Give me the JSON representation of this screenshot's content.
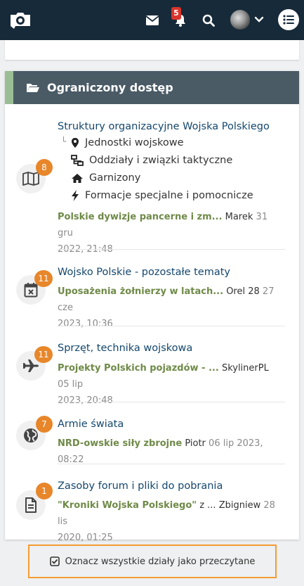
{
  "header": {
    "notification_count": "5"
  },
  "category": {
    "title": "Ograniczony dostęp",
    "forums": [
      {
        "title": "Struktury organizacyjne Wojska Polskiego",
        "count": "8",
        "icon": "map-icon",
        "subforums": [
          {
            "label": "Jednostki wojskowe",
            "icon": "map-marker-icon"
          },
          {
            "label": "Oddziały i związki taktyczne",
            "icon": "sitemap-icon"
          },
          {
            "label": "Garnizony",
            "icon": "home-icon"
          },
          {
            "label": "Formacje specjalne i pomocnicze",
            "icon": "bolt-icon"
          }
        ],
        "last_topic": "Polskie dywizje pancerne i zm...",
        "last_user": "Marek",
        "last_date_a": "31 gru",
        "last_date_b": "2022, 21:48"
      },
      {
        "title": "Wojsko Polskie - pozostałe tematy",
        "count": "11",
        "icon": "calendar-x-icon",
        "last_topic": "Uposażenia żołnierzy w latach...",
        "last_user": "Orel 28",
        "last_date_a": "27 cze",
        "last_date_b": "2023, 10:36"
      },
      {
        "title": "Sprzęt, technika wojskowa",
        "count": "11",
        "icon": "plane-icon",
        "last_topic": "Projekty Polskich pojazdów - ...",
        "last_user": "SkylinerPL",
        "last_date_a": "05 lip",
        "last_date_b": "2023, 20:48"
      },
      {
        "title": "Armie świata",
        "count": "7",
        "icon": "globe-icon",
        "last_topic": "NRD-owskie siły zbrojne",
        "last_user": "Piotr",
        "last_date_a": "06 lip 2023, 08:22"
      },
      {
        "title": "Zasoby forum i pliki do pobrania",
        "count": "1",
        "icon": "file-icon",
        "last_topic": "\"Kroniki Wojska Polskiego\"",
        "last_mid": " z ...",
        "last_user": "Zbigniew",
        "last_date_a": "28 lis",
        "last_date_b": "2020, 01:25"
      }
    ]
  },
  "mark_all_read": "Oznacz wszystkie działy jako przeczytane",
  "colors": {
    "topbar": "#172a3a",
    "header_bar": "#4a5b66",
    "header_accent": "#9bbd95",
    "count_badge": "#e8862a",
    "forum_title": "#14476e",
    "last_topic": "#6f8a48",
    "highlight_border": "#f39c34"
  }
}
